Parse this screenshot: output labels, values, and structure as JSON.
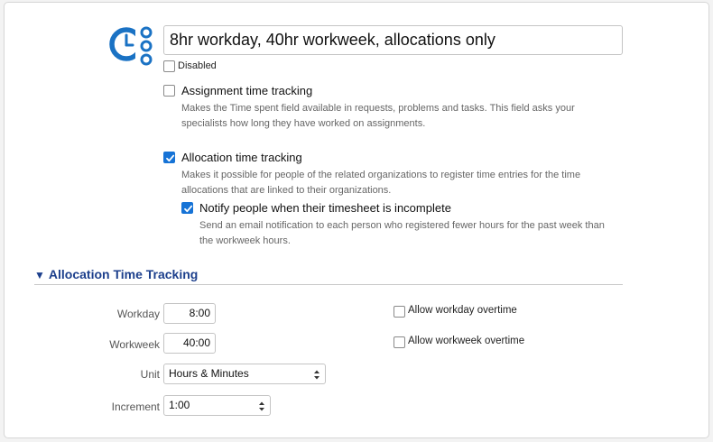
{
  "header": {
    "title_value": "8hr workday, 40hr workweek, allocations only",
    "disabled_label": "Disabled",
    "logo_icon": "time-tracking-logo-icon",
    "accent_color": "#1a72c4"
  },
  "options": {
    "assignment": {
      "label": "Assignment time tracking",
      "description": "Makes the Time spent field available in requests, problems and tasks. This field asks your specialists how long they have worked on assignments.",
      "checked": false
    },
    "allocation": {
      "label": "Allocation time tracking",
      "description": "Makes it possible for people of the related organizations to register time entries for the time allocations that are linked to their organizations.",
      "checked": true
    },
    "notify": {
      "label": "Notify people when their timesheet is incomplete",
      "description": "Send an email notification to each person who registered fewer hours for the past week than the workweek hours.",
      "checked": true
    }
  },
  "section": {
    "title": "Allocation Time Tracking",
    "collapse_icon": "triangle-down-icon"
  },
  "fields": {
    "workday_label": "Workday",
    "workday_value": "8:00",
    "workweek_label": "Workweek",
    "workweek_value": "40:00",
    "unit_label": "Unit",
    "unit_value": "Hours & Minutes",
    "increment_label": "Increment",
    "increment_value": "1:00",
    "allow_workday_overtime": "Allow workday overtime",
    "allow_workweek_overtime": "Allow workweek overtime"
  }
}
